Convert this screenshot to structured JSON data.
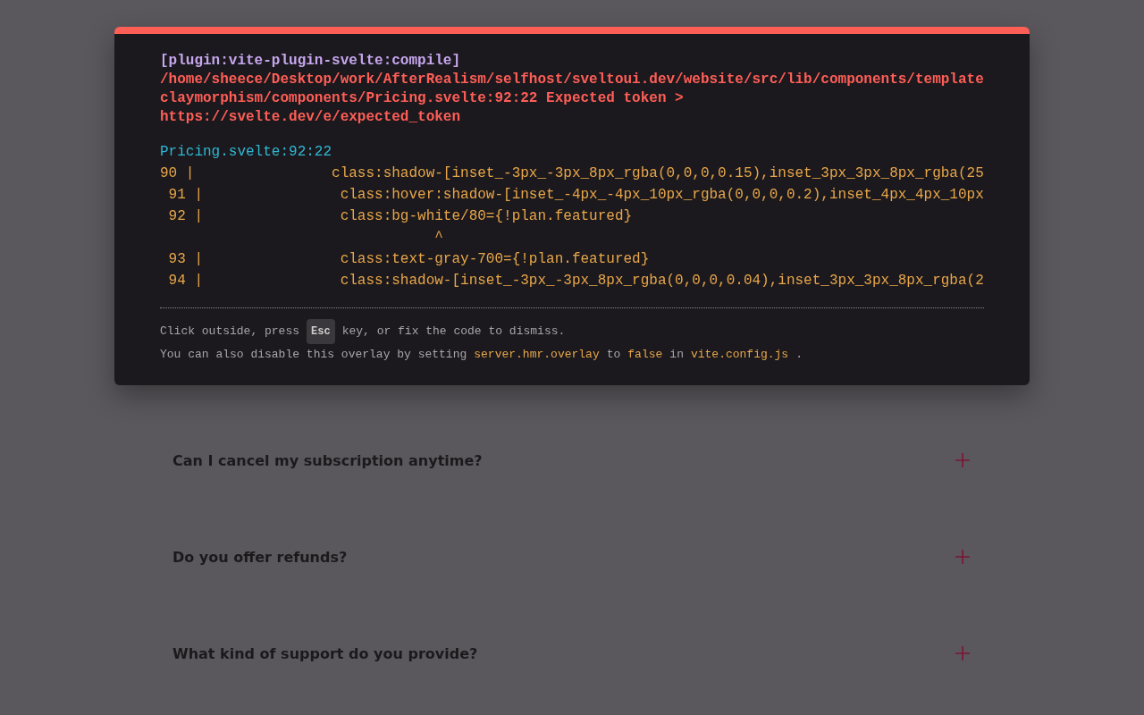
{
  "error_overlay": {
    "plugin": "[plugin:vite-plugin-svelte:compile]",
    "message_lines": [
      "/home/sheece/Desktop/work/AfterRealism/selfhost/sveltoui.dev/website/src/lib/components/template",
      "claymorphism/components/Pricing.svelte:92:22 Expected token >",
      "https://svelte.dev/e/expected_token"
    ],
    "file": "Pricing.svelte:92:22",
    "frame": [
      "90 |                class:shadow-[inset_-3px_-3px_8px_rgba(0,0,0,0.15),inset_3px_3px_8px_rgba(25",
      " 91 |                class:hover:shadow-[inset_-4px_-4px_10px_rgba(0,0,0,0.2),inset_4px_4px_10px",
      " 92 |                class:bg-white/80={!plan.featured}",
      "                                ^",
      " 93 |                class:text-gray-700={!plan.featured}",
      " 94 |                class:shadow-[inset_-3px_-3px_8px_rgba(0,0,0,0.04),inset_3px_3px_8px_rgba(2"
    ],
    "tip_before": "Click outside, press",
    "tip_key": "Esc",
    "tip_after": "key, or fix the code to dismiss.",
    "tip2": [
      {
        "kind": "text",
        "text": "You can also disable this overlay by setting"
      },
      {
        "kind": "code",
        "text": "server.hmr.overlay"
      },
      {
        "kind": "text",
        "text": "to"
      },
      {
        "kind": "code",
        "text": "false"
      },
      {
        "kind": "text",
        "text": "in"
      },
      {
        "kind": "code",
        "text": "vite.config.js"
      },
      {
        "kind": "text",
        "text": "."
      }
    ]
  },
  "faq": [
    {
      "question": "Can I cancel my subscription anytime?",
      "expanded": false
    },
    {
      "question": "Do you offer refunds?",
      "expanded": false
    },
    {
      "question": "What kind of support do you provide?",
      "expanded": false
    }
  ]
}
